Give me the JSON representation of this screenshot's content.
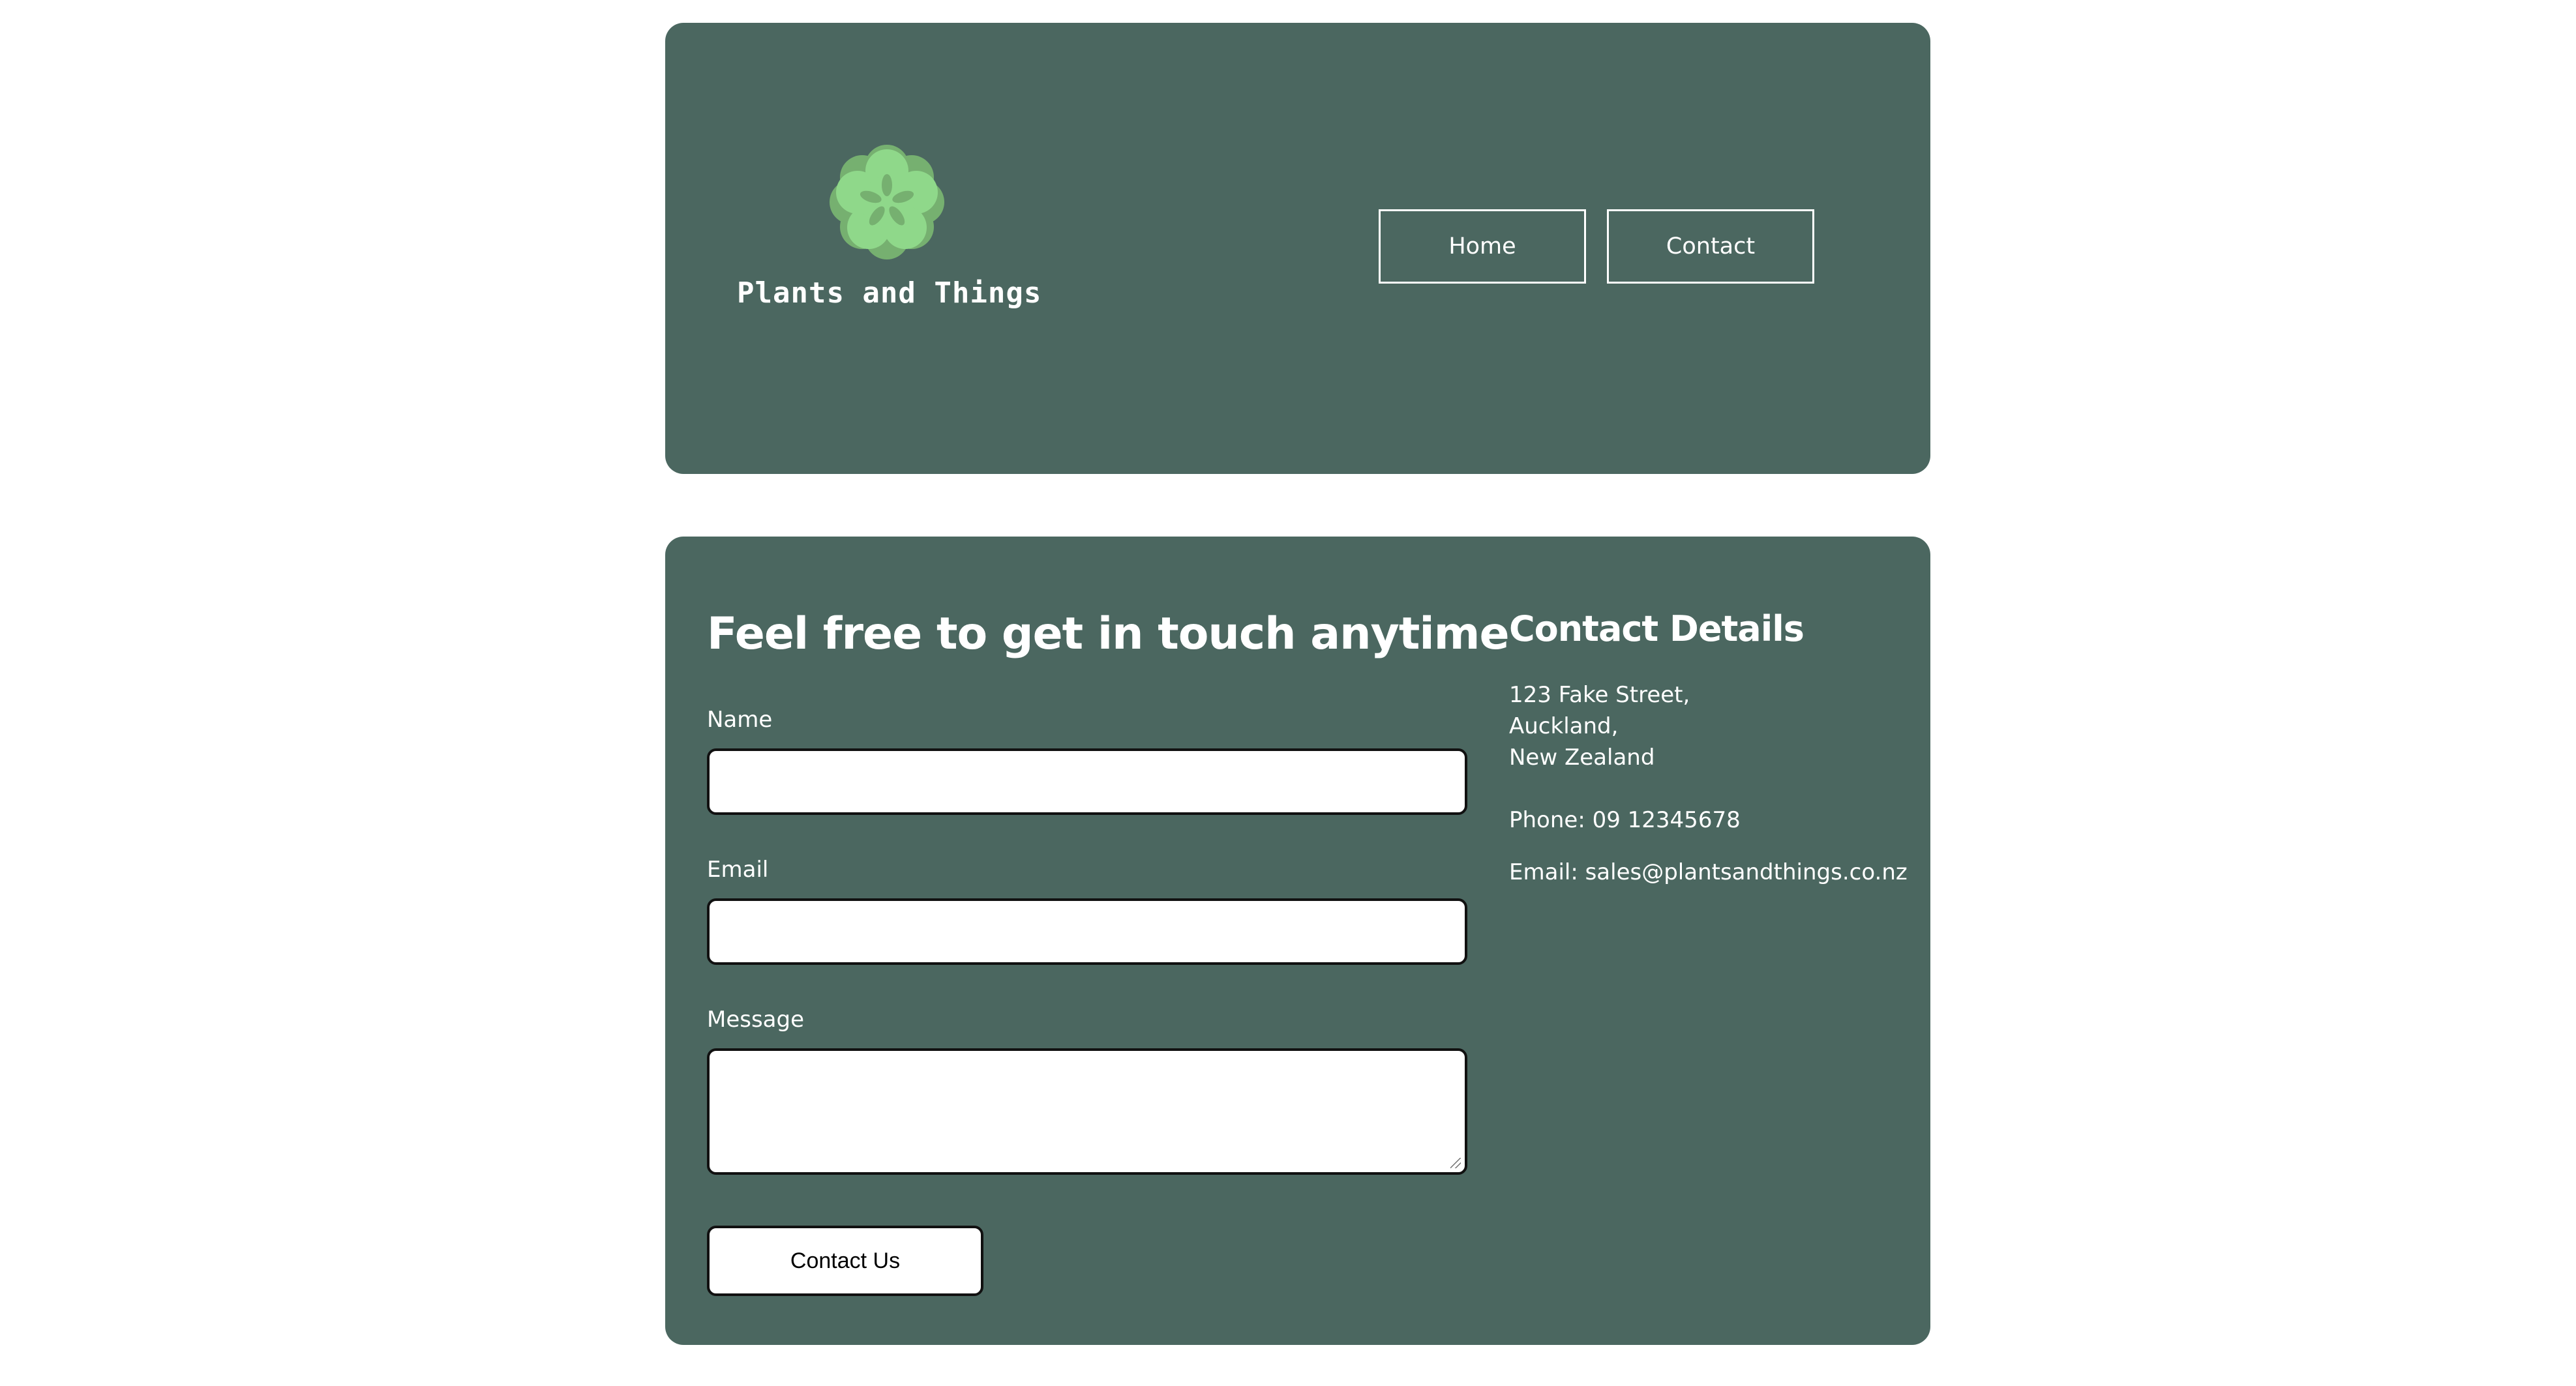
{
  "header": {
    "brand_name": "Plants and Things",
    "logo_icon": "flower-logo-icon",
    "nav": [
      {
        "label": "Home"
      },
      {
        "label": "Contact"
      }
    ]
  },
  "contact_form": {
    "heading": "Feel free to get in touch anytime",
    "fields": {
      "name": {
        "label": "Name",
        "value": "",
        "placeholder": ""
      },
      "email": {
        "label": "Email",
        "value": "",
        "placeholder": ""
      },
      "message": {
        "label": "Message",
        "value": "",
        "placeholder": ""
      }
    },
    "submit_label": "Contact Us"
  },
  "contact_details": {
    "heading": "Contact Details",
    "address_lines": [
      "123 Fake Street,",
      "Auckland,",
      "New Zealand"
    ],
    "phone": "Phone: 09 12345678",
    "email": "Email: sales@plantsandthings.co.nz"
  },
  "colors": {
    "panel": "#4b6760",
    "text": "#ffffff",
    "logo_light": "#8fd88a",
    "logo_dark": "#76b070"
  }
}
